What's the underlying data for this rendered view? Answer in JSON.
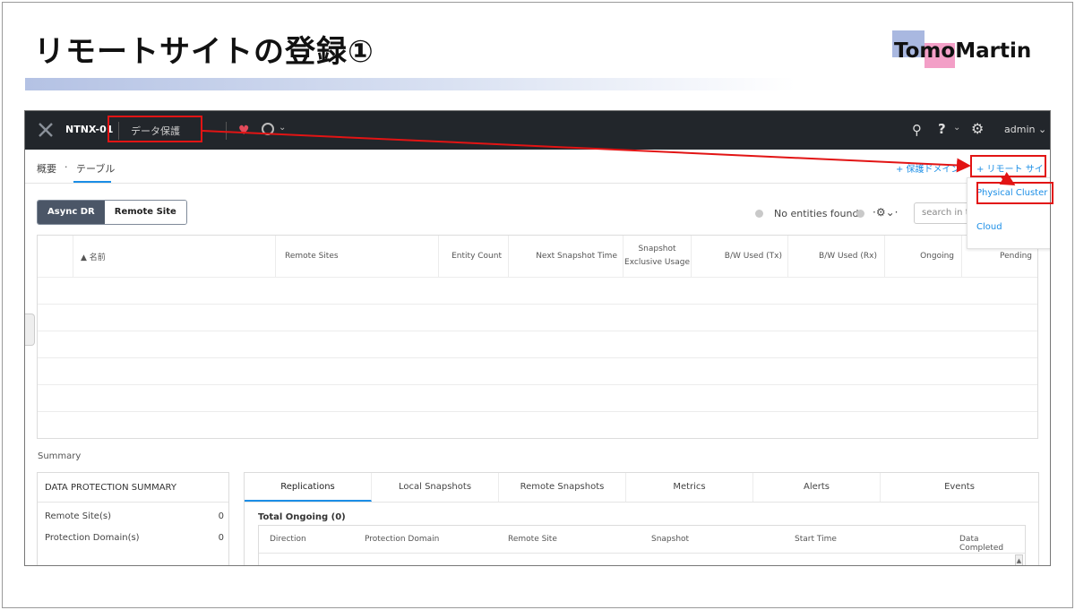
{
  "slide": {
    "title": "リモートサイトの登録①",
    "logo_text": "TomoMartin"
  },
  "topbar": {
    "cluster_name": "NTNX-01",
    "menu_label": "データ保護",
    "admin_label": "admin",
    "help_label": "?"
  },
  "subnav": {
    "overview": "概要",
    "separator": "·",
    "table": "テーブル",
    "protection_domain_link": "+ 保護ドメイン",
    "remote_site_link": "+ リモート サイト"
  },
  "dropdown": {
    "options": [
      "Physical Cluster",
      "Cloud"
    ]
  },
  "view_toggle": {
    "async_dr": "Async DR",
    "remote_site": "Remote Site"
  },
  "status": {
    "entities": "No entities found",
    "search_placeholder": "search in table"
  },
  "table": {
    "columns": [
      "▲ 名前",
      "Remote Sites",
      "Entity Count",
      "Next Snapshot Time",
      "Snapshot Exclusive Usage",
      "B/W Used (Tx)",
      "B/W Used (Rx)",
      "Ongoing",
      "Pending"
    ]
  },
  "summary": {
    "label": "Summary",
    "box_title": "DATA PROTECTION SUMMARY",
    "rows": [
      {
        "label": "Remote Site(s)",
        "value": "0"
      },
      {
        "label": "Protection Domain(s)",
        "value": "0"
      }
    ]
  },
  "tabs": {
    "items": [
      "Replications",
      "Local Snapshots",
      "Remote Snapshots",
      "Metrics",
      "Alerts",
      "Events"
    ],
    "active": "Replications",
    "total_ongoing": "Total Ongoing (0)",
    "columns": [
      "Direction",
      "Protection Domain",
      "Remote Site",
      "Snapshot",
      "Start Time",
      "Data Completed"
    ]
  },
  "colors": {
    "accent_blue": "#1b8ee6",
    "annotation_red": "#e21414",
    "topbar_bg": "#22262b"
  }
}
